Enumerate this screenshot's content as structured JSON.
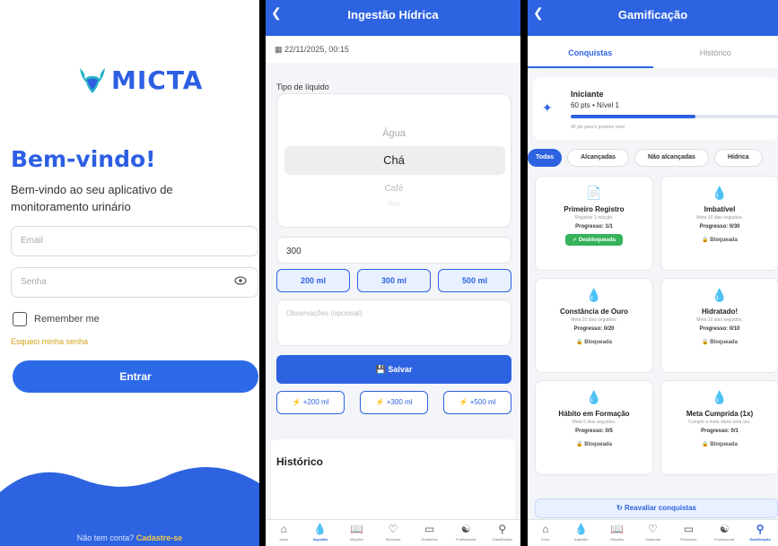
{
  "login": {
    "logo_text": "MICTA",
    "welcome_title": "Bem-vindo!",
    "welcome_subtitle": "Bem-vindo ao seu aplicativo de monitoramento urinário",
    "email_placeholder": "Email",
    "password_placeholder": "Senha",
    "remember_label": "Remember me",
    "forgot_link": "Esqueci minha senha",
    "enter_button": "Entrar",
    "signup_text": "Não tem conta?",
    "signup_link": "Cadastre-se"
  },
  "hydration": {
    "title": "Ingestão Hídrica",
    "datetime": "22/11/2025, 00:15",
    "liquid_type_label": "Tipo de líquido",
    "liquid_options": [
      "Água",
      "Chá",
      "Café",
      "Suco"
    ],
    "selected_liquid": "Chá",
    "volume_value": "300",
    "quick_amounts": [
      "200 ml",
      "300 ml",
      "500 ml"
    ],
    "notes_placeholder": "Observações (opcional)",
    "save_button": "Salvar",
    "add_buttons": [
      "+200 ml",
      "+300 ml",
      "+500 ml"
    ],
    "history_title": "Histórico"
  },
  "nav": {
    "items": [
      "Início",
      "Ingestão",
      "Micções",
      "Sintomas",
      "Relatórios",
      "Profissionais",
      "Gamificação"
    ]
  },
  "gamification": {
    "title": "Gamificação",
    "tabs": [
      "Conquistas",
      "Histórico"
    ],
    "level": {
      "name": "Iniciante",
      "points": "60 pts • Nível 1",
      "progress": 0.6,
      "next_text": "40 pts para o próximo nível"
    },
    "filters": [
      "Todas",
      "Alcançadas",
      "Não alcançadas",
      "Hídrica"
    ],
    "achievements": [
      {
        "name": "Primeiro Registro",
        "desc": "Registrar 1 micção.",
        "progress": "Progresso: 1/1",
        "status": "Desbloqueada",
        "unlocked": true
      },
      {
        "name": "Imbatível",
        "desc": "Meta 30 dias seguidos.",
        "progress": "Progresso: 0/30",
        "status": "Bloqueada",
        "unlocked": false
      },
      {
        "name": "Constância de Ouro",
        "desc": "Meta 20 dias seguidos.",
        "progress": "Progresso: 0/20",
        "status": "Bloqueada",
        "unlocked": false
      },
      {
        "name": "Hidratado!",
        "desc": "Meta 10 dias seguidos.",
        "progress": "Progresso: 0/10",
        "status": "Bloqueada",
        "unlocked": false
      },
      {
        "name": "Hábito em Formação",
        "desc": "Meta 5 dias seguidos.",
        "progress": "Progresso: 0/5",
        "status": "Bloqueada",
        "unlocked": false
      },
      {
        "name": "Meta Cumprida (1x)",
        "desc": "Cumprir a meta diária uma vez.",
        "progress": "Progresso: 0/1",
        "status": "Bloqueada",
        "unlocked": false
      }
    ],
    "reevaluate_button": "Reavaliar conquistas"
  },
  "colors": {
    "primary": "#2d63e0",
    "accent_yellow": "#d4a014",
    "success": "#35b25a"
  }
}
